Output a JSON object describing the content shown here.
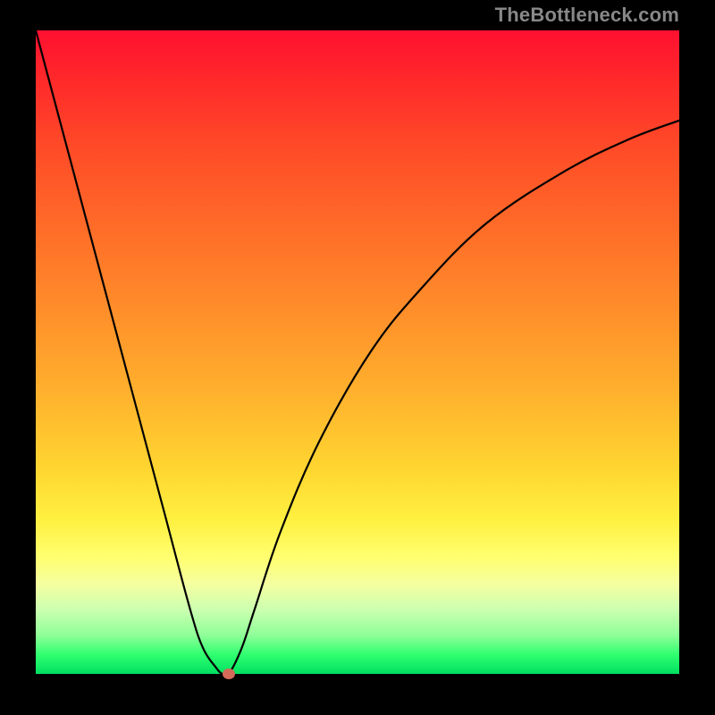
{
  "watermark": "TheBottleneck.com",
  "chart_data": {
    "type": "line",
    "title": "",
    "xlabel": "",
    "ylabel": "",
    "xlim": [
      0,
      100
    ],
    "ylim": [
      0,
      100
    ],
    "grid": false,
    "background_gradient": {
      "top": "#ff1030",
      "bottom": "#00e060",
      "stops": [
        "red",
        "orange",
        "yellow",
        "green"
      ]
    },
    "series": [
      {
        "name": "bottleneck-curve",
        "x": [
          0,
          4,
          8,
          12,
          16,
          20,
          24,
          26,
          28,
          29,
          30,
          32,
          34,
          38,
          44,
          52,
          60,
          70,
          82,
          92,
          100
        ],
        "y": [
          100,
          85,
          70,
          55,
          40,
          25,
          10,
          4,
          1,
          0,
          0,
          4,
          10,
          22,
          36,
          50,
          60,
          70,
          78,
          83,
          86
        ]
      }
    ],
    "marker": {
      "x": 30,
      "y": 0,
      "color": "#d46a5a"
    }
  }
}
